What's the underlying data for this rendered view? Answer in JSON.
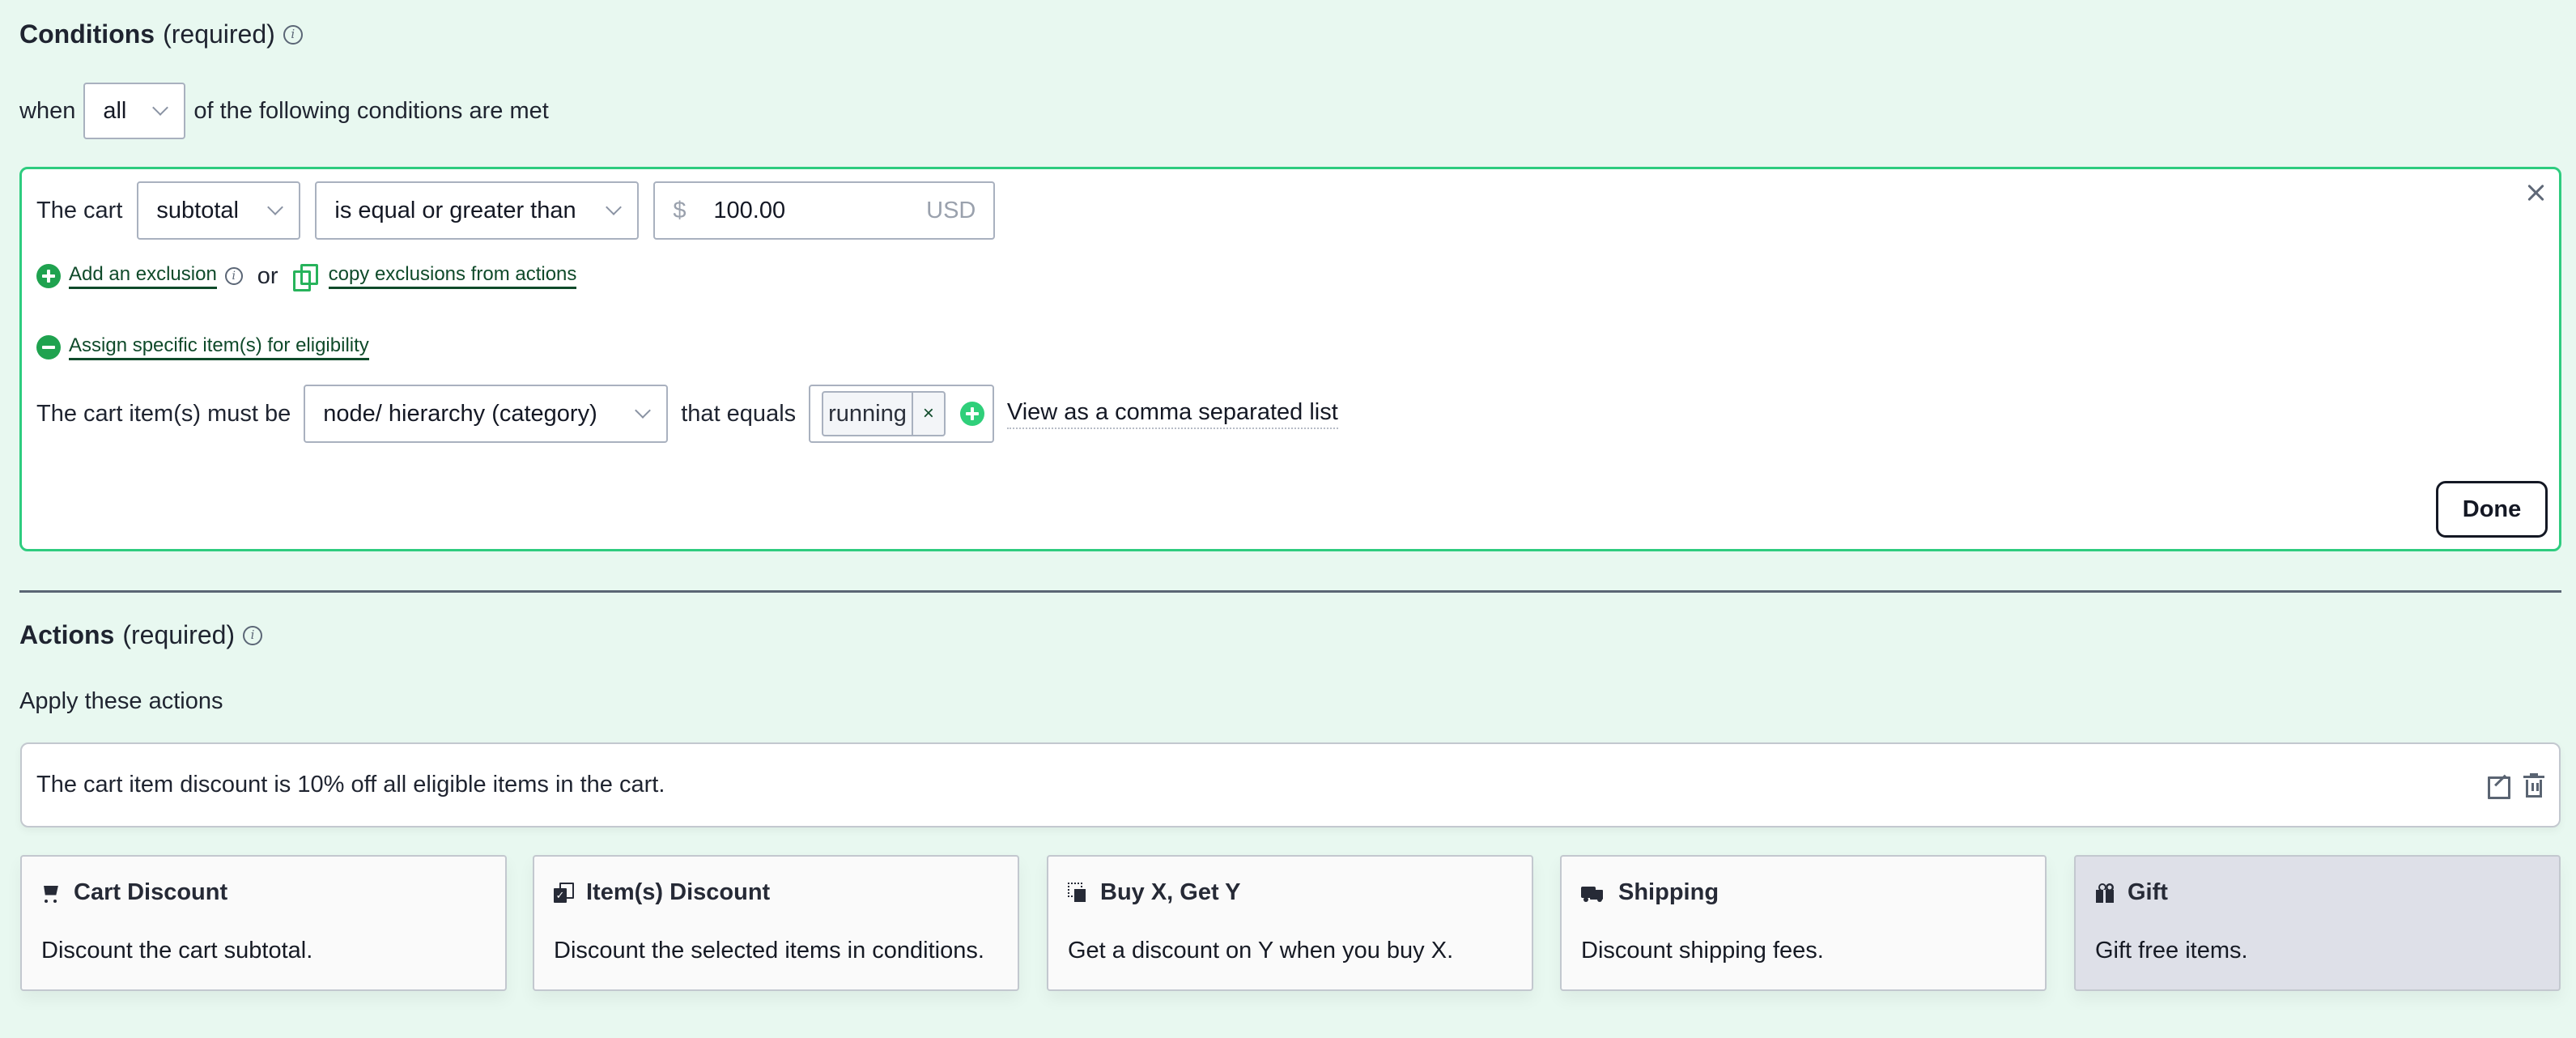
{
  "conditions": {
    "title": "Conditions",
    "required_label": "(required)",
    "info_icon": "i",
    "when_label": "when",
    "match_select": {
      "value": "all"
    },
    "match_suffix": "of the following conditions are met",
    "rule": {
      "subject_label": "The cart",
      "attribute_select": {
        "value": "subtotal"
      },
      "operator_select": {
        "value": "is equal or greater than"
      },
      "amount": {
        "currency_symbol": "$",
        "value": "100.00",
        "unit": "USD"
      },
      "add_exclusion_label": "Add an exclusion",
      "or_label": "or",
      "copy_exclusions_label": "copy exclusions from actions",
      "assign_items_label": "Assign specific item(s) for eligibility",
      "items_label": "The cart item(s) must be",
      "items_attribute_select": {
        "value": "node/ hierarchy (category)"
      },
      "equals_label": "that equals",
      "tags": [
        {
          "label": "running",
          "remove": "×"
        }
      ],
      "view_list_label": "View as a comma separated list",
      "done_label": "Done"
    }
  },
  "actions": {
    "title": "Actions",
    "required_label": "(required)",
    "info_icon": "i",
    "apply_label": "Apply these actions",
    "summary": "The cart item discount is 10% off all eligible items in the cart.",
    "cards": [
      {
        "icon": "cart-icon",
        "title": "Cart Discount",
        "description": "Discount the cart subtotal.",
        "selected": false
      },
      {
        "icon": "items-check-icon",
        "title": "Item(s) Discount",
        "description": "Discount the selected items in conditions.",
        "selected": false
      },
      {
        "icon": "buy-x-get-y-icon",
        "title": "Buy X, Get Y",
        "description": "Get a discount on Y when you buy X.",
        "selected": false
      },
      {
        "icon": "truck-icon",
        "title": "Shipping",
        "description": "Discount shipping fees.",
        "selected": false
      },
      {
        "icon": "gift-icon",
        "title": "Gift",
        "description": "Gift free items.",
        "selected": true
      }
    ]
  },
  "colors": {
    "background": "#e8f8f0",
    "accent_green": "#2ecc7f",
    "link_green": "#0f4a2a",
    "icon_green": "#1fa24f",
    "selected_card": "#dee0e8"
  }
}
